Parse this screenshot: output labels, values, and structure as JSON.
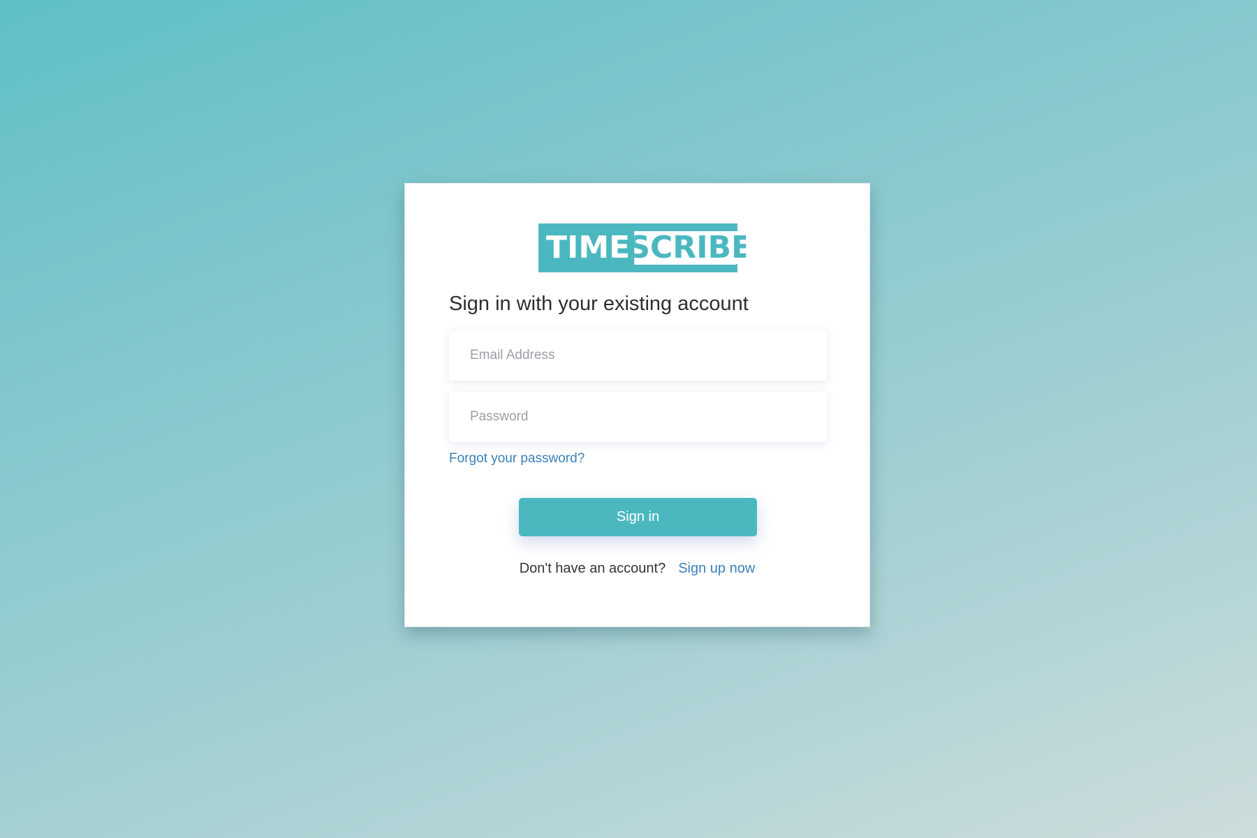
{
  "logo": {
    "part1": "TIME",
    "part2": "SCRIBE"
  },
  "login": {
    "heading": "Sign in with your existing account",
    "email_placeholder": "Email Address",
    "email_value": "",
    "password_placeholder": "Password",
    "password_value": "",
    "forgot_link": "Forgot your password?",
    "signin_button": "Sign in",
    "signup_prompt": "Don't have an account?",
    "signup_link": "Sign up now"
  },
  "colors": {
    "brand": "#4bb8c0",
    "link": "#3a80b8",
    "text": "#2b2f33"
  }
}
